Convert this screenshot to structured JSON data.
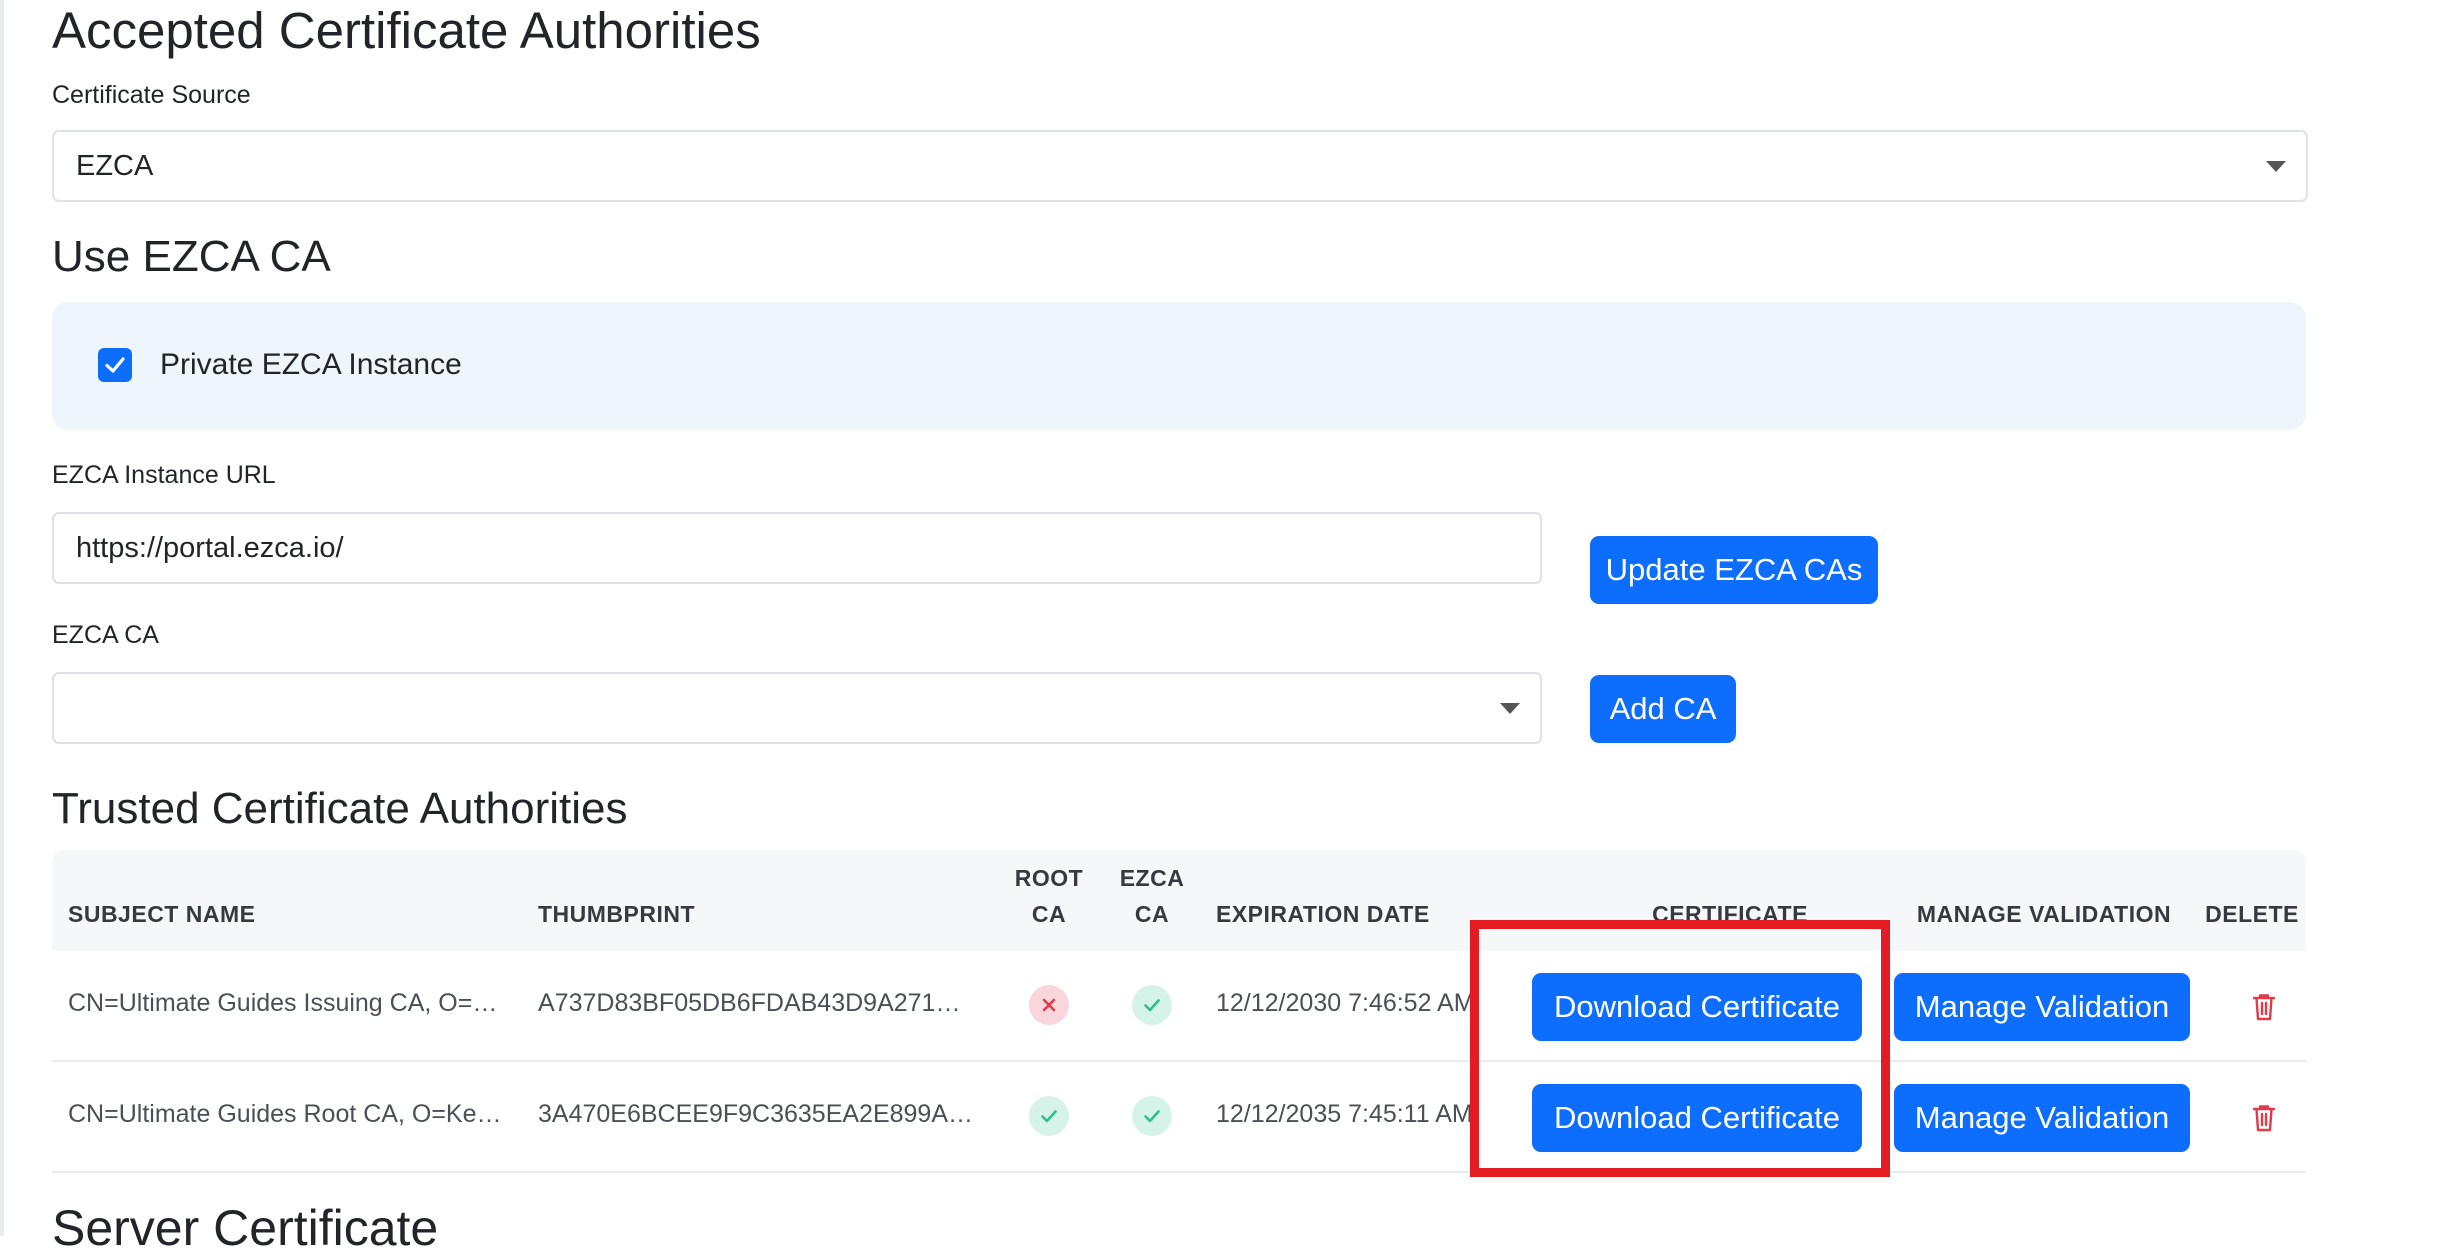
{
  "section_title": "Accepted Certificate Authorities",
  "certificate_source": {
    "label": "Certificate Source",
    "value": "EZCA"
  },
  "use_ezca": {
    "title": "Use EZCA CA",
    "private_instance": {
      "label": "Private EZCA Instance",
      "checked": true
    },
    "instance_url": {
      "label": "EZCA Instance URL",
      "value": "https://portal.ezca.io/"
    },
    "update_button": "Update EZCA CAs",
    "ezca_ca": {
      "label": "EZCA CA",
      "value": ""
    },
    "add_button": "Add CA"
  },
  "trusted": {
    "title": "Trusted Certificate Authorities",
    "headers": {
      "subject_name": "SUBJECT NAME",
      "thumbprint": "THUMBPRINT",
      "root_ca_1": "ROOT",
      "root_ca_2": "CA",
      "ezca_ca_1": "EZCA",
      "ezca_ca_2": "CA",
      "expiration": "EXPIRATION DATE",
      "certificate": "CERTIFICATE",
      "manage_validation": "MANAGE VALIDATION",
      "delete": "DELETE"
    },
    "rows": [
      {
        "subject": "CN=Ultimate Guides Issuing CA, O=…",
        "thumbprint": "A737D83BF05DB6FDAB43D9A271…",
        "root_ca": false,
        "ezca_ca": true,
        "expiration": "12/12/2030 7:46:52 AM",
        "download_label": "Download Certificate",
        "manage_label": "Manage Validation"
      },
      {
        "subject": "CN=Ultimate Guides Root CA, O=Ke…",
        "thumbprint": "3A470E6BCEE9F9C3635EA2E899A…",
        "root_ca": true,
        "ezca_ca": true,
        "expiration": "12/12/2035 7:45:11 AM",
        "download_label": "Download Certificate",
        "manage_label": "Manage Validation"
      }
    ]
  },
  "next_section_title": "Server Certificate",
  "colors": {
    "primary": "#0d6efd",
    "highlight": "#e41b23",
    "success": "#2fbf8a",
    "danger": "#e03a4c"
  }
}
